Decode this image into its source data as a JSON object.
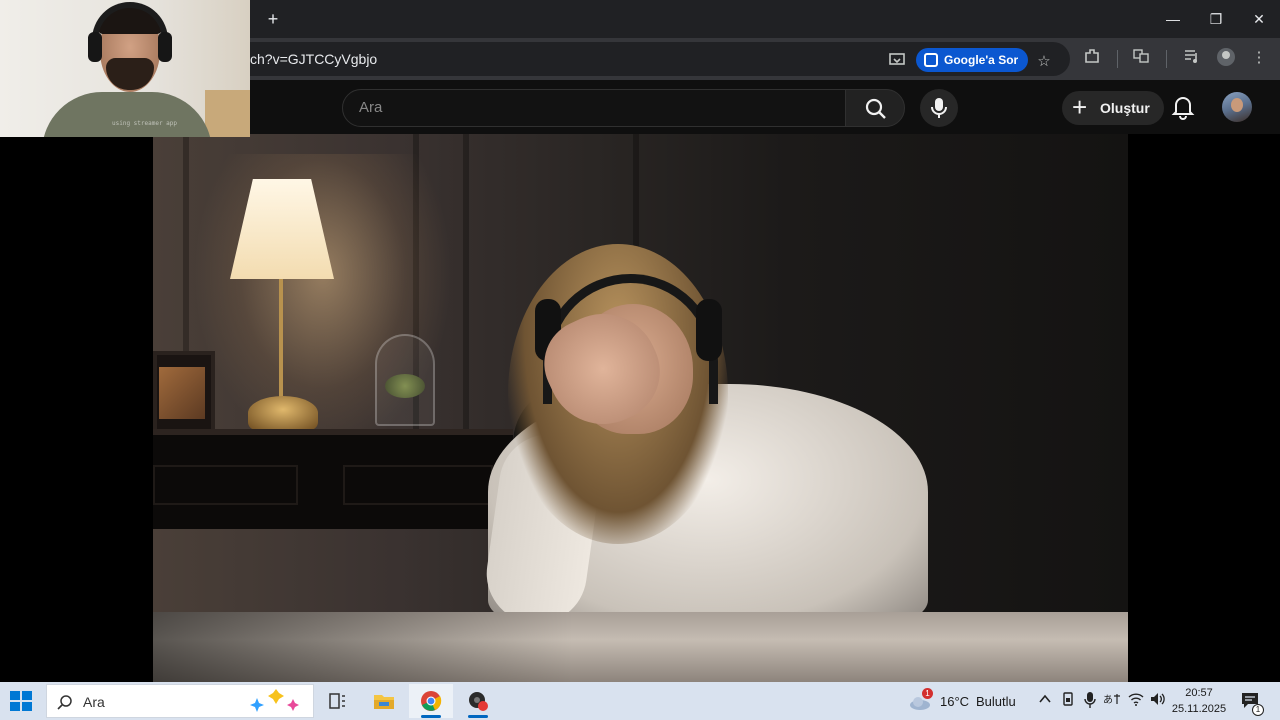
{
  "browser": {
    "url_fragment": "ch?v=GJTCCyVgbjo",
    "new_tab_label": "+",
    "google_ask_label": "Google'a Sor",
    "window_controls": {
      "minimize": "—",
      "restore": "❐",
      "close": "✕"
    }
  },
  "youtube": {
    "search": {
      "placeholder": "Ara"
    },
    "create_label": "Oluştur"
  },
  "webcam": {
    "caption": "using streamer app"
  },
  "taskbar": {
    "search_placeholder": "Ara",
    "weather": {
      "temperature": "16°C",
      "condition": "Bulutlu",
      "alert_count": "1"
    },
    "clock": {
      "time": "20:57",
      "date": "25.11.2025"
    },
    "notification_count": "1",
    "colors": {
      "accent": "#0067c0",
      "background": "#d9e2ef"
    }
  },
  "colors": {
    "chrome_bg": "#202124",
    "youtube_bg": "#0f0f0f",
    "google_ask_bg": "#0b57d0"
  }
}
